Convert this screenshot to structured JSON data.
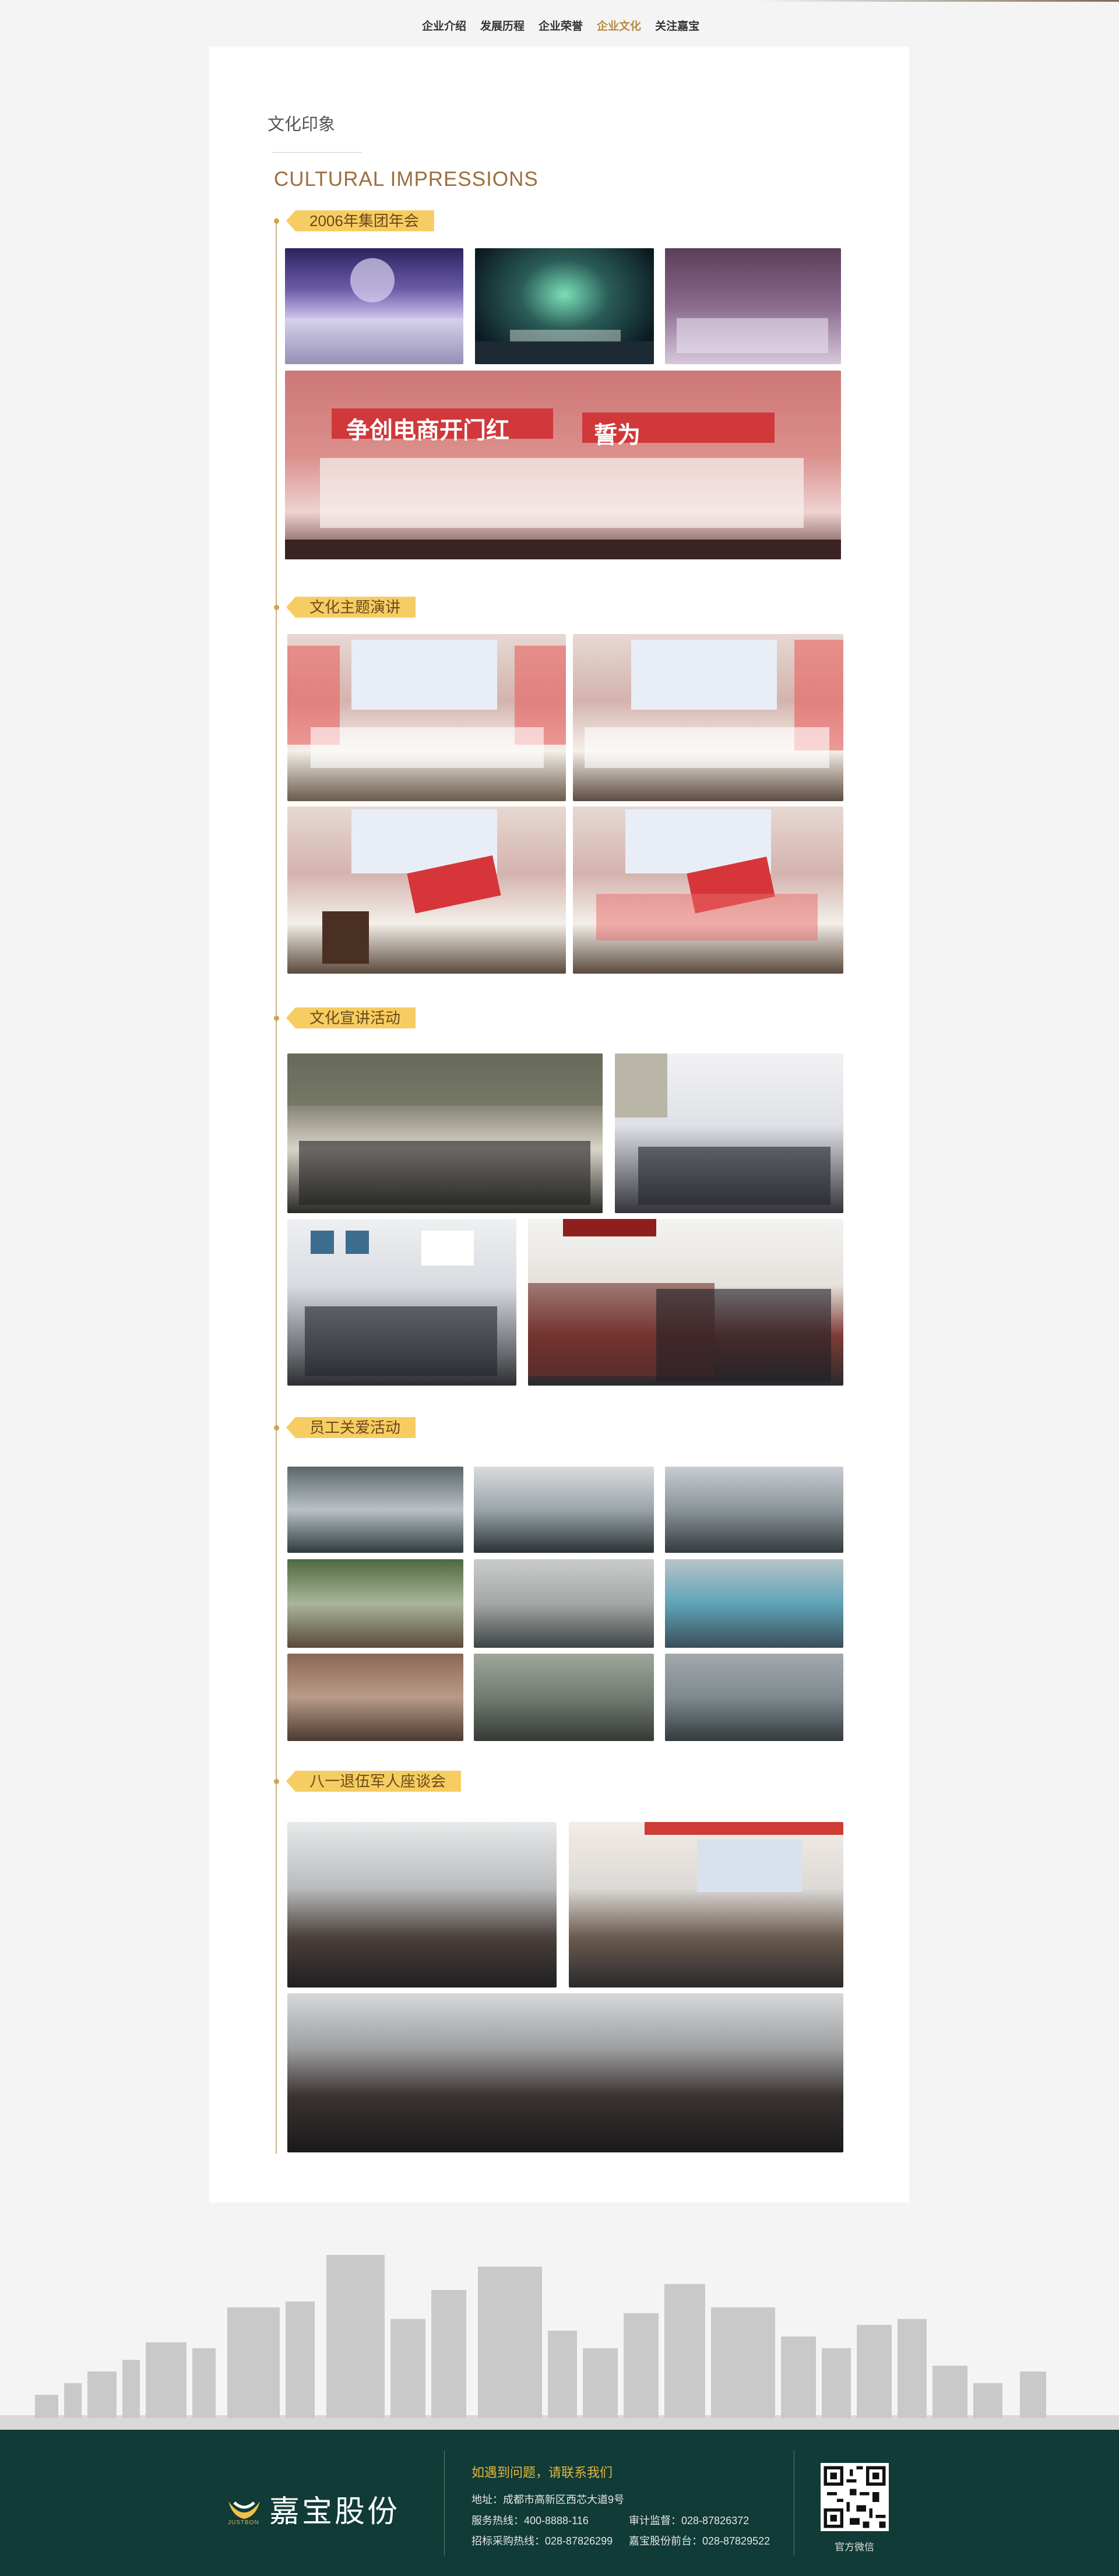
{
  "nav": {
    "items": [
      {
        "label": "企业介绍",
        "active": false
      },
      {
        "label": "发展历程",
        "active": false
      },
      {
        "label": "企业荣誉",
        "active": false
      },
      {
        "label": "企业文化",
        "active": true
      },
      {
        "label": "关注嘉宝",
        "active": false
      }
    ]
  },
  "heading": {
    "title_cn": "文化印象",
    "title_en": "CULTURAL IMPRESSIONS"
  },
  "sections": [
    {
      "title": "2006年集团年会"
    },
    {
      "title": "文化主题演讲"
    },
    {
      "title": "文化宣讲活动"
    },
    {
      "title": "员工关爱活动"
    },
    {
      "title": "八一退伍军人座谈会"
    }
  ],
  "photo_banners": {
    "banner1_left": "争创电商开门红",
    "banner1_right": "誓为"
  },
  "footer": {
    "brand_cn": "嘉宝股份",
    "brand_en": "JUSTBON",
    "contact_title": "如遇到问题，请联系我们",
    "address": "地址：成都市高新区西芯大道9号",
    "hotline": "服务热线：400-8888-116",
    "audit": "审计监督：028-87826372",
    "procurement": "招标采购热线：028-87826299",
    "frontdesk": "嘉宝股份前台：028-87829522",
    "qr_label": "官方微信"
  }
}
